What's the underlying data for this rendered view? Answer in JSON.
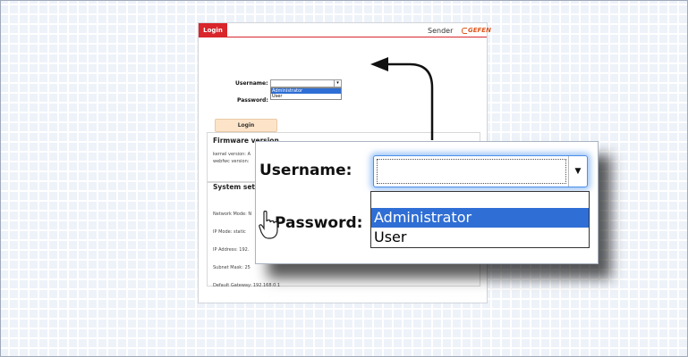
{
  "background": {
    "stripe": "#eef2f9",
    "accent_red": "#d8262b",
    "highlight_blue": "#2f6ed4"
  },
  "page": {
    "tab": "Login",
    "device_name": "Sender",
    "brand": "GEFEN",
    "login_form": {
      "username_label": "Username:",
      "username_value": "",
      "username_options": [
        "Administrator",
        "User"
      ],
      "username_highlighted": "Administrator",
      "password_label": "Password:",
      "password_value": "",
      "login_button": "Login"
    },
    "firmware": {
      "title": "Firmware version",
      "kernel": "kernel version: A",
      "webfwc": "webfwc version:"
    },
    "system": {
      "title": "System setti",
      "network_mode": "Network Mode: N",
      "ip_mode": "IP Mode: static",
      "ip_address": "IP Address: 192.",
      "subnet_mask": "Subnet Mask: 25",
      "default_gateway": "Default Gateway: 192.168.0.1"
    }
  },
  "zoom_callout": {
    "username_label": "Username:",
    "password_label": "Password:",
    "select_value": "",
    "options": [
      "Administrator",
      "User"
    ],
    "highlighted": "Administrator"
  },
  "icons": {
    "dropdown_arrow": "chevron-down-icon",
    "pointer": "mouse-pointer-icon",
    "callout_arrow": "callout-arrow-icon"
  }
}
